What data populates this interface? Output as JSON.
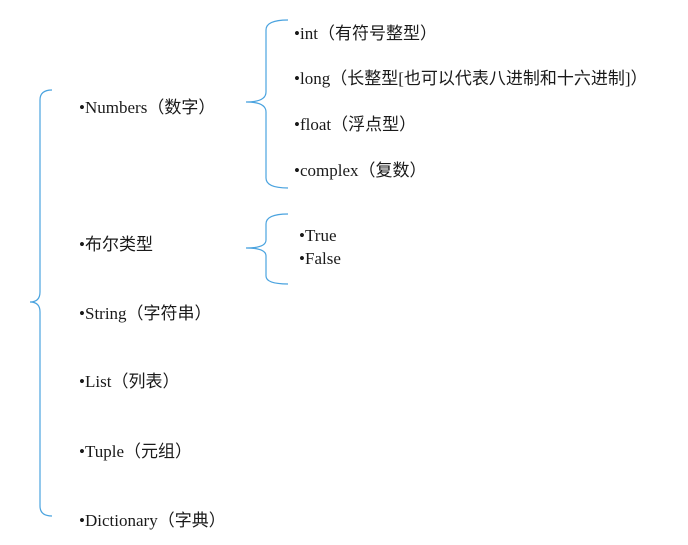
{
  "bullet": "•",
  "bracket_color": "#4aa3df",
  "types": [
    {
      "label": "Numbers（数字）"
    },
    {
      "label": "布尔类型"
    },
    {
      "label": "String（字符串）"
    },
    {
      "label": "List（列表）"
    },
    {
      "label": "Tuple（元组）"
    },
    {
      "label": "Dictionary（字典）"
    }
  ],
  "numbers_subtypes": [
    {
      "label": "int（有符号整型）"
    },
    {
      "label": "long（长整型[也可以代表八进制和十六进制]）"
    },
    {
      "label": "float（浮点型）"
    },
    {
      "label": "complex（复数）"
    }
  ],
  "bool_values": [
    {
      "label": "True"
    },
    {
      "label": "False"
    }
  ]
}
